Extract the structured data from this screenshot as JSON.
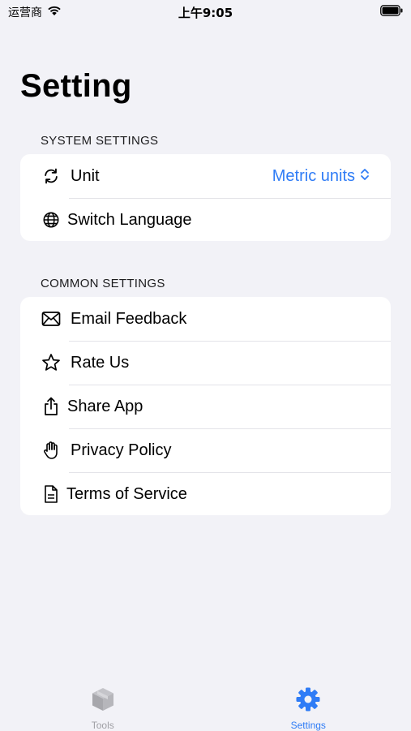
{
  "status_bar": {
    "carrier": "运营商",
    "time": "上午9:05"
  },
  "page": {
    "title": "Setting"
  },
  "sections": [
    {
      "header": "SYSTEM SETTINGS",
      "items": [
        {
          "label": "Unit",
          "icon": "arrows-cycle-icon",
          "value": "Metric units"
        },
        {
          "label": "Switch Language",
          "icon": "globe-icon"
        }
      ]
    },
    {
      "header": "COMMON SETTINGS",
      "items": [
        {
          "label": "Email Feedback",
          "icon": "envelope-icon"
        },
        {
          "label": "Rate Us",
          "icon": "star-icon"
        },
        {
          "label": "Share App",
          "icon": "share-icon"
        },
        {
          "label": "Privacy Policy",
          "icon": "hand-icon"
        },
        {
          "label": "Terms of Service",
          "icon": "document-icon"
        }
      ]
    }
  ],
  "tab_bar": {
    "tabs": [
      {
        "label": "Tools",
        "icon": "cube-icon",
        "selected": false
      },
      {
        "label": "Settings",
        "icon": "gear-icon",
        "selected": true
      }
    ]
  },
  "colors": {
    "accent": "#2f7cf6",
    "background": "#f2f2f7",
    "inactive_tab": "#a0a0a5"
  }
}
